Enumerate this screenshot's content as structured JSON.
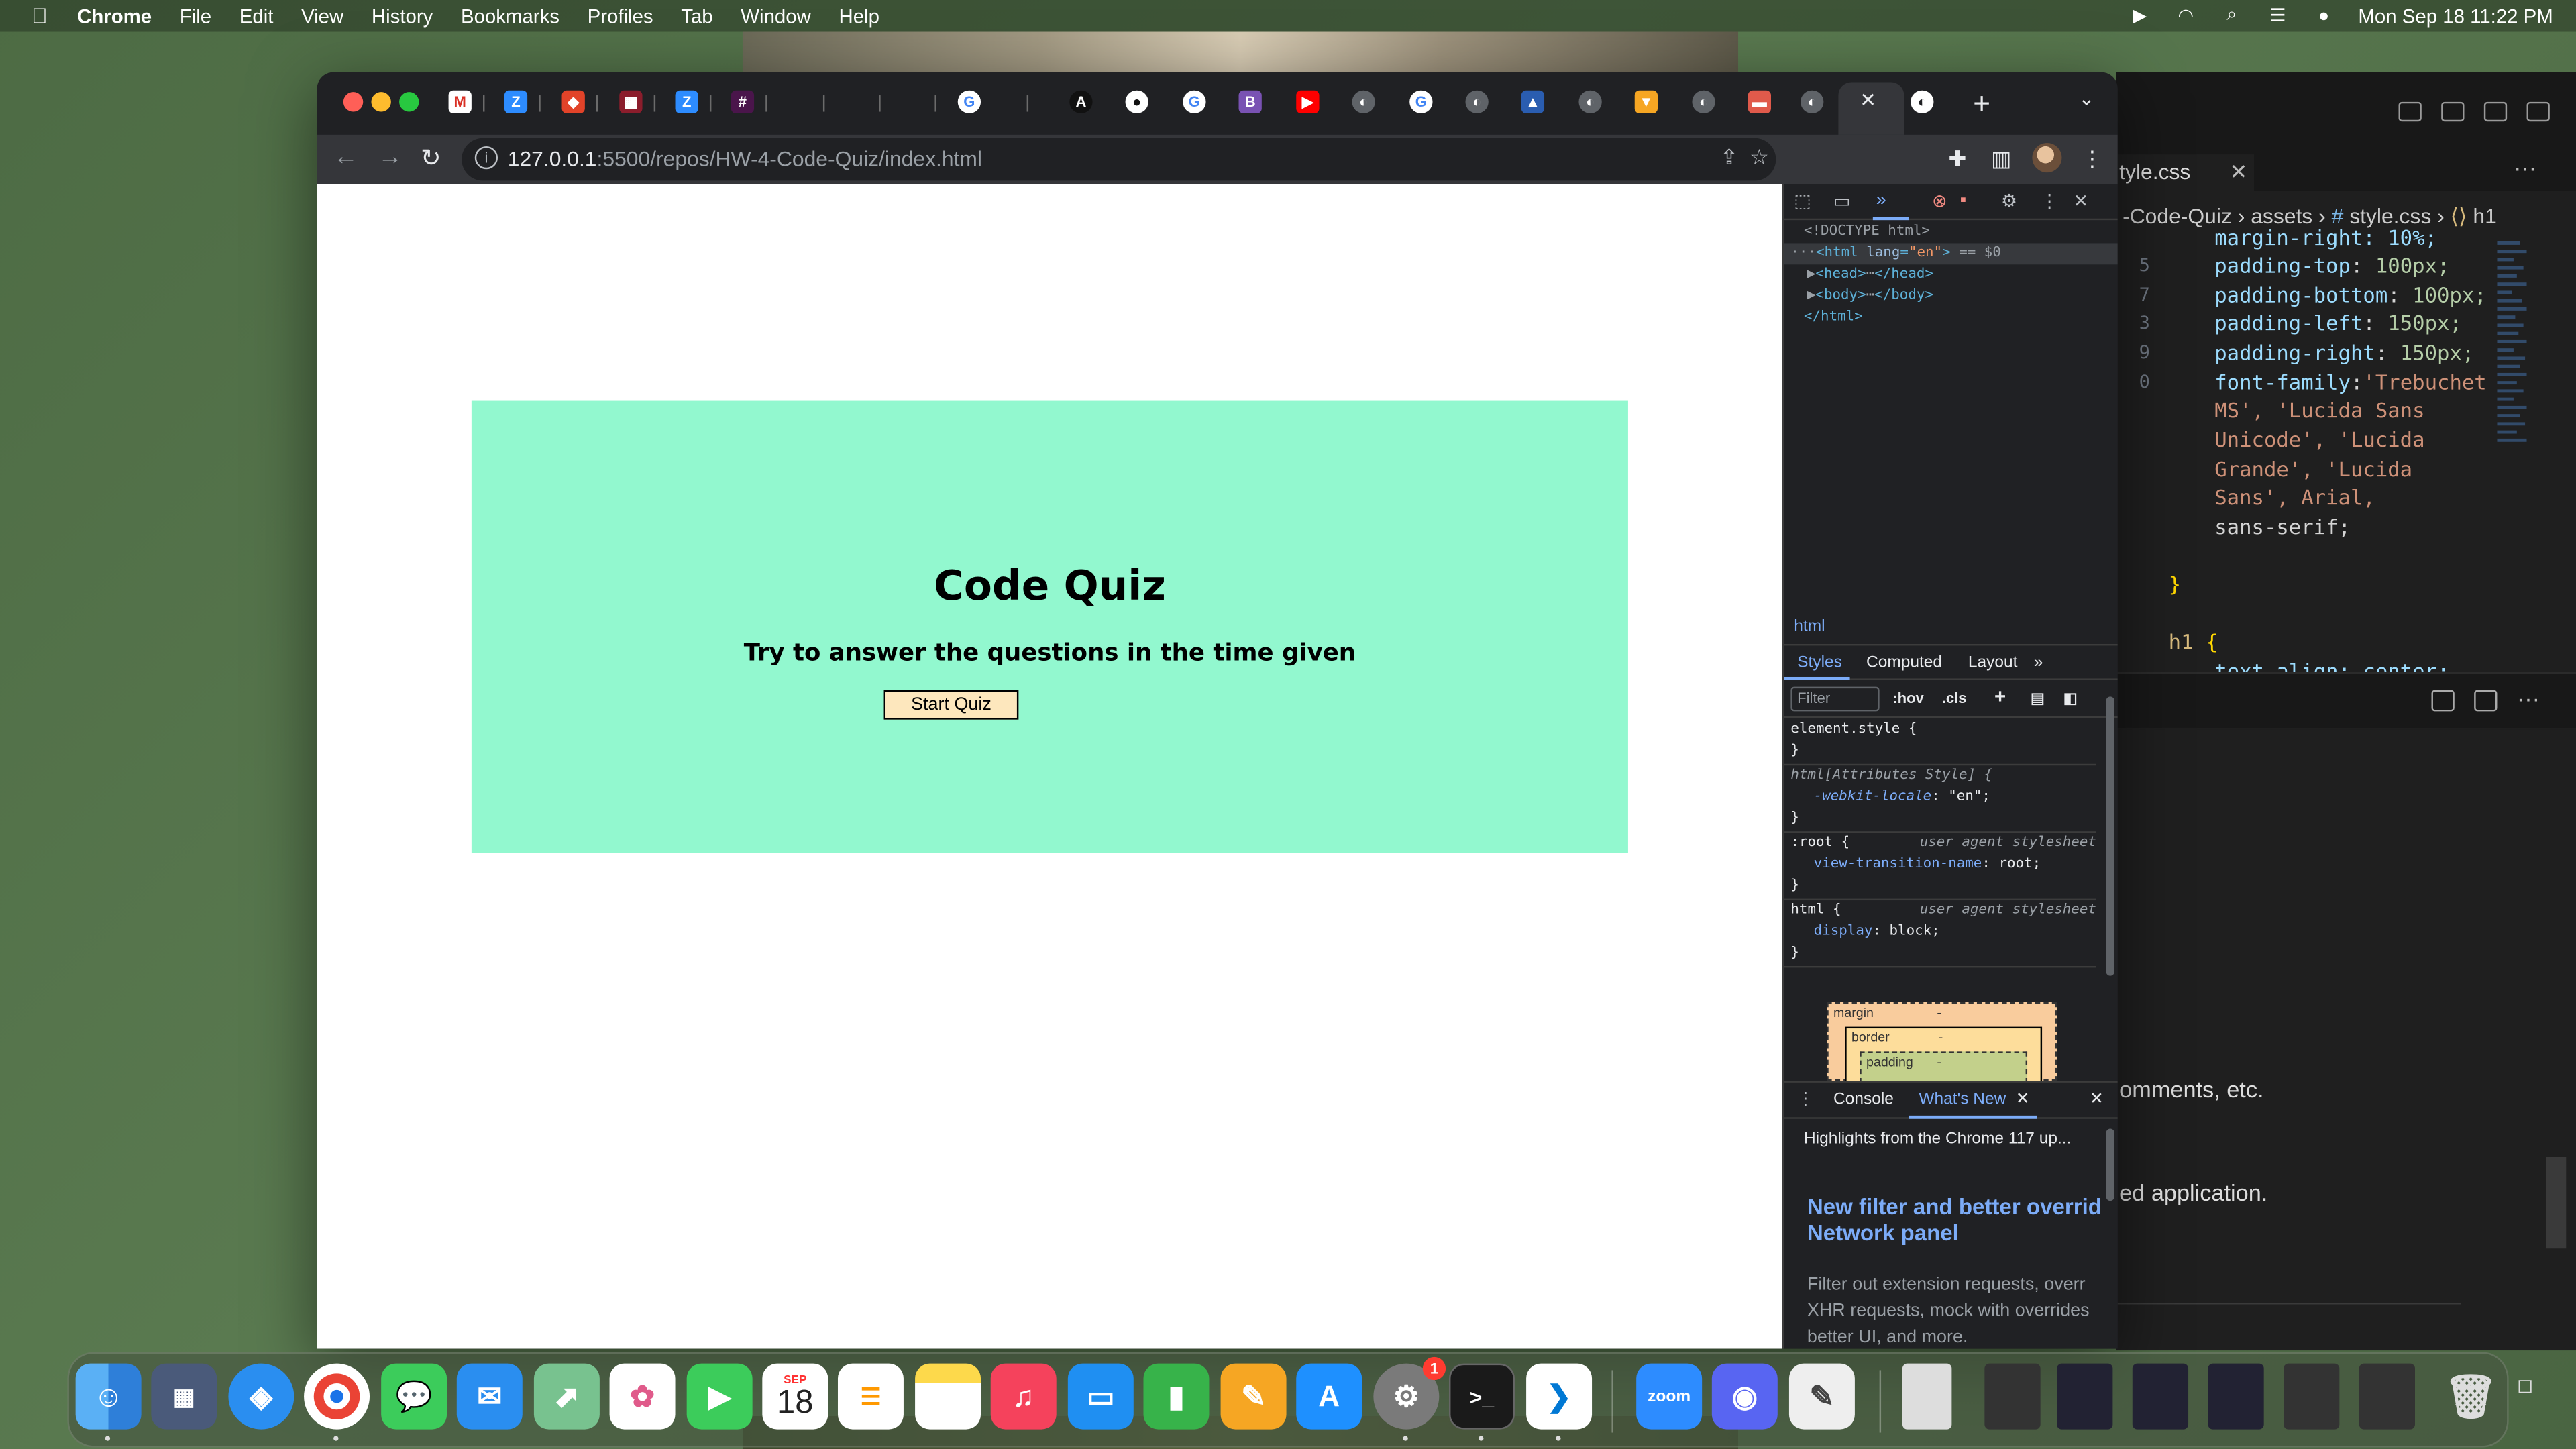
{
  "menubar": {
    "apple": "",
    "items": [
      "Chrome",
      "File",
      "Edit",
      "View",
      "History",
      "Bookmarks",
      "Profiles",
      "Tab",
      "Window",
      "Help"
    ],
    "clock": "Mon Sep 18  11:22 PM"
  },
  "browser": {
    "url_host": "127.0.0.1",
    "url_path": ":5500/repos/HW-4-Code-Quiz/index.html",
    "new_tab": "+",
    "close_tab": "✕"
  },
  "page": {
    "title": "Code Quiz",
    "subtitle": "Try to answer the questions in the time given",
    "start_button": "Start Quiz"
  },
  "devtools": {
    "dom": {
      "doctype": "<!DOCTYPE html>",
      "html_open": "<html",
      "lang_attr": "lang",
      "lang_val": "\"en\"",
      "html_close_bracket": ">",
      "eq": " == $0",
      "head": "<head>",
      "head_close": "</head>",
      "body": "<body>",
      "body_close": "</body>",
      "html_end": "</html>",
      "ellipsis": "⋯"
    },
    "breadcrumb": "html",
    "style_tabs": [
      "Styles",
      "Computed",
      "Layout"
    ],
    "filter_placeholder": "Filter",
    "hov": ":hov",
    "cls": ".cls",
    "rules": {
      "element_style": "element.style {",
      "attr_style_sel": "html[Attributes Style] {",
      "locale_prop": "-webkit-locale",
      "locale_val": "\"en\";",
      "root_sel": ":root {",
      "ua": "user agent stylesheet",
      "vtn_prop": "view-transition-name",
      "vtn_val": "root;",
      "html_sel": "html {",
      "display_prop": "display",
      "display_val": "block;",
      "close": "}"
    },
    "box_model": {
      "margin": "margin",
      "border": "border",
      "padding": "padding",
      "dash": "-"
    },
    "drawer_tabs": [
      "Console",
      "What's New"
    ],
    "whatsnew_head": "Highlights from the Chrome 117 up...",
    "whatsnew_title_1": "New filter and better overrid",
    "whatsnew_title_2": "Network panel",
    "whatsnew_body_1": "Filter out extension requests, overr",
    "whatsnew_body_2": "XHR requests, mock with overrides",
    "whatsnew_body_3": "better UI, and more."
  },
  "vscode": {
    "tab": "tyle.css",
    "breadcrumb_1": "-Code-Quiz",
    "breadcrumb_2": "assets",
    "breadcrumb_3": "style.css",
    "breadcrumb_4": "h1",
    "code": [
      {
        "ln": "",
        "text": "margin-right: 10%;"
      },
      {
        "ln": "5",
        "prop": "padding-top",
        "val": "100px;"
      },
      {
        "ln": "7",
        "prop": "padding-bottom",
        "val": "100px;"
      },
      {
        "ln": "3",
        "prop": "padding-left",
        "val": "150px;"
      },
      {
        "ln": "9",
        "prop": "padding-right",
        "val": "150px;"
      },
      {
        "ln": "0",
        "prop": "font-family",
        "val": "'Trebuchet"
      }
    ],
    "font_cont_1": "MS', 'Lucida Sans",
    "font_cont_2": "Unicode', 'Lucida",
    "font_cont_3": "Grande', 'Lucida",
    "font_cont_4": "Sans', Arial,",
    "font_cont_5": "sans-serif;",
    "close_brace": "}",
    "h1_sel": "h1",
    "h1_brace": "{",
    "text_align": "text-align: center;",
    "panel_text_1": "omments, etc.",
    "panel_text_2": "ed application."
  },
  "dock": {
    "calendar_month": "SEP",
    "calendar_day": "18",
    "zoom_label": "zoom",
    "settings_badge": "1",
    "terminal_prompt": ">_"
  }
}
